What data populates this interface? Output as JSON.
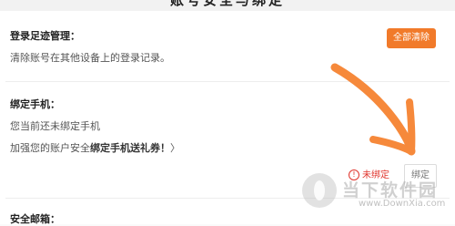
{
  "header": {
    "title": "账号安全与绑定"
  },
  "login_footprint": {
    "title": "登录足迹管理：",
    "description": "清除账号在其他设备上的登录记录。",
    "clear_all_button": "全部清除"
  },
  "phone_binding": {
    "title": "绑定手机：",
    "status_text": "您当前还未绑定手机",
    "promo_prefix": "加强您的账户安全",
    "promo_bold": "绑定手机送礼券！",
    "promo_chevron": "〉",
    "status_badge": "未绑定",
    "bind_button": "绑定"
  },
  "email_section": {
    "title": "安全邮箱："
  },
  "watermark": {
    "cn": "当下软件园",
    "en": "www.DownXia.com"
  },
  "colors": {
    "accent": "#f17a2a",
    "warning": "#e0342c",
    "annotation_stroke": "#f6893b"
  },
  "icons": {
    "warning": "warning-icon",
    "logo": "site-logo-icon"
  }
}
